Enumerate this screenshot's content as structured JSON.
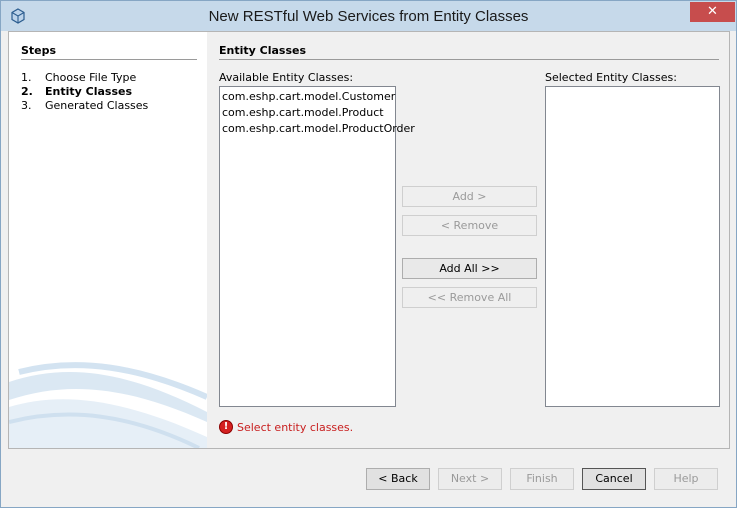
{
  "window": {
    "title": "New RESTful Web Services from Entity Classes",
    "close_glyph": "✕",
    "icon": "netbeans-cube-icon"
  },
  "steps": {
    "title": "Steps",
    "items": [
      {
        "num": "1.",
        "label": "Choose File Type",
        "current": false
      },
      {
        "num": "2.",
        "label": "Entity Classes",
        "current": true
      },
      {
        "num": "3.",
        "label": "Generated Classes",
        "current": false
      }
    ]
  },
  "main": {
    "title": "Entity Classes",
    "available_label": "Available Entity Classes:",
    "selected_label": "Selected Entity Classes:",
    "available_items": [
      "com.eshp.cart.model.Customer",
      "com.eshp.cart.model.Product",
      "com.eshp.cart.model.ProductOrder"
    ],
    "selected_items": [],
    "buttons": {
      "add": "Add >",
      "remove": "< Remove",
      "add_all": "Add All >>",
      "remove_all": "<< Remove All"
    },
    "error_message": "Select entity classes.",
    "error_icon": "error-icon",
    "error_color": "#c81e1e"
  },
  "footer": {
    "back": "< Back",
    "next": "Next >",
    "finish": "Finish",
    "cancel": "Cancel",
    "help": "Help"
  },
  "colors": {
    "titlebar": "#c6d9ea",
    "close_button": "#c74d4d",
    "panel": "#f0f0f0"
  }
}
